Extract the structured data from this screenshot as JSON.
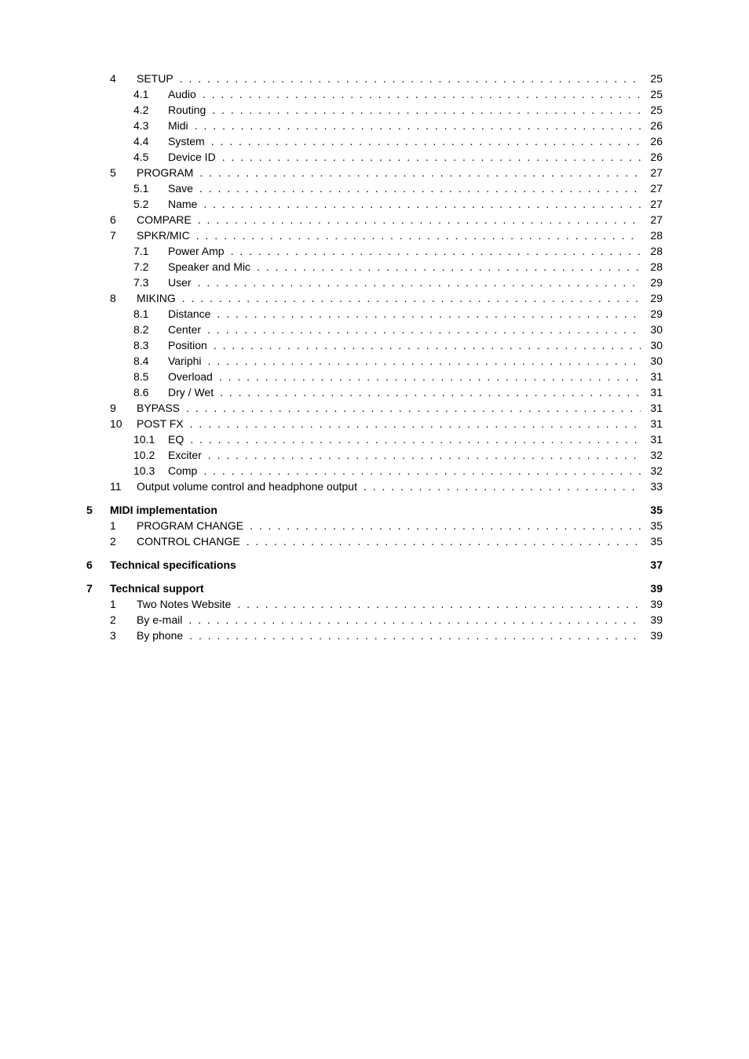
{
  "toc": [
    {
      "level": 2,
      "num": "4",
      "sub": "",
      "title": "SETUP",
      "page": "25",
      "bold": false,
      "dotted": true,
      "gap": false
    },
    {
      "level": 3,
      "num": "",
      "sub": "4.1",
      "title": "Audio",
      "page": "25",
      "bold": false,
      "dotted": true,
      "gap": false
    },
    {
      "level": 3,
      "num": "",
      "sub": "4.2",
      "title": "Routing",
      "page": "25",
      "bold": false,
      "dotted": true,
      "gap": false
    },
    {
      "level": 3,
      "num": "",
      "sub": "4.3",
      "title": "Midi",
      "page": "26",
      "bold": false,
      "dotted": true,
      "gap": false
    },
    {
      "level": 3,
      "num": "",
      "sub": "4.4",
      "title": "System",
      "page": "26",
      "bold": false,
      "dotted": true,
      "gap": false
    },
    {
      "level": 3,
      "num": "",
      "sub": "4.5",
      "title": "Device ID",
      "page": "26",
      "bold": false,
      "dotted": true,
      "gap": false
    },
    {
      "level": 2,
      "num": "5",
      "sub": "",
      "title": "PROGRAM",
      "page": "27",
      "bold": false,
      "dotted": true,
      "gap": false
    },
    {
      "level": 3,
      "num": "",
      "sub": "5.1",
      "title": "Save",
      "page": "27",
      "bold": false,
      "dotted": true,
      "gap": false
    },
    {
      "level": 3,
      "num": "",
      "sub": "5.2",
      "title": "Name",
      "page": "27",
      "bold": false,
      "dotted": true,
      "gap": false
    },
    {
      "level": 2,
      "num": "6",
      "sub": "",
      "title": "COMPARE",
      "page": "27",
      "bold": false,
      "dotted": true,
      "gap": false
    },
    {
      "level": 2,
      "num": "7",
      "sub": "",
      "title": "SPKR/MIC",
      "page": "28",
      "bold": false,
      "dotted": true,
      "gap": false
    },
    {
      "level": 3,
      "num": "",
      "sub": "7.1",
      "title": "Power Amp",
      "page": "28",
      "bold": false,
      "dotted": true,
      "gap": false
    },
    {
      "level": 3,
      "num": "",
      "sub": "7.2",
      "title": "Speaker and Mic",
      "page": "28",
      "bold": false,
      "dotted": true,
      "gap": false
    },
    {
      "level": 3,
      "num": "",
      "sub": "7.3",
      "title": "User",
      "page": "29",
      "bold": false,
      "dotted": true,
      "gap": false
    },
    {
      "level": 2,
      "num": "8",
      "sub": "",
      "title": "MIKING",
      "page": "29",
      "bold": false,
      "dotted": true,
      "gap": false
    },
    {
      "level": 3,
      "num": "",
      "sub": "8.1",
      "title": "Distance",
      "page": "29",
      "bold": false,
      "dotted": true,
      "gap": false
    },
    {
      "level": 3,
      "num": "",
      "sub": "8.2",
      "title": "Center",
      "page": "30",
      "bold": false,
      "dotted": true,
      "gap": false
    },
    {
      "level": 3,
      "num": "",
      "sub": "8.3",
      "title": "Position",
      "page": "30",
      "bold": false,
      "dotted": true,
      "gap": false
    },
    {
      "level": 3,
      "num": "",
      "sub": "8.4",
      "title": "Variphi",
      "page": "30",
      "bold": false,
      "dotted": true,
      "gap": false
    },
    {
      "level": 3,
      "num": "",
      "sub": "8.5",
      "title": "Overload",
      "page": "31",
      "bold": false,
      "dotted": true,
      "gap": false
    },
    {
      "level": 3,
      "num": "",
      "sub": "8.6",
      "title": "Dry / Wet",
      "page": "31",
      "bold": false,
      "dotted": true,
      "gap": false
    },
    {
      "level": 2,
      "num": "9",
      "sub": "",
      "title": "BYPASS",
      "page": "31",
      "bold": false,
      "dotted": true,
      "gap": false
    },
    {
      "level": 2,
      "num": "10",
      "sub": "",
      "title": "POST FX",
      "page": "31",
      "bold": false,
      "dotted": true,
      "gap": false
    },
    {
      "level": 3,
      "num": "",
      "sub": "10.1",
      "title": "EQ",
      "page": "31",
      "bold": false,
      "dotted": true,
      "gap": false
    },
    {
      "level": 3,
      "num": "",
      "sub": "10.2",
      "title": "Exciter",
      "page": "32",
      "bold": false,
      "dotted": true,
      "gap": false
    },
    {
      "level": 3,
      "num": "",
      "sub": "10.3",
      "title": "Comp",
      "page": "32",
      "bold": false,
      "dotted": true,
      "gap": false
    },
    {
      "level": 2,
      "num": "11",
      "sub": "",
      "title": "Output volume control and headphone output",
      "page": "33",
      "bold": false,
      "dotted": true,
      "gap": false
    },
    {
      "level": 1,
      "num": "5",
      "sub": "",
      "title": "MIDI implementation",
      "page": "35",
      "bold": true,
      "dotted": false,
      "gap": true
    },
    {
      "level": 2,
      "num": "1",
      "sub": "",
      "title": "PROGRAM CHANGE",
      "page": "35",
      "bold": false,
      "dotted": true,
      "gap": false
    },
    {
      "level": 2,
      "num": "2",
      "sub": "",
      "title": "CONTROL CHANGE",
      "page": "35",
      "bold": false,
      "dotted": true,
      "gap": false
    },
    {
      "level": 1,
      "num": "6",
      "sub": "",
      "title": "Technical specifications",
      "page": "37",
      "bold": true,
      "dotted": false,
      "gap": true
    },
    {
      "level": 1,
      "num": "7",
      "sub": "",
      "title": "Technical support",
      "page": "39",
      "bold": true,
      "dotted": false,
      "gap": true
    },
    {
      "level": 2,
      "num": "1",
      "sub": "",
      "title": "Two Notes Website",
      "page": "39",
      "bold": false,
      "dotted": true,
      "gap": false
    },
    {
      "level": 2,
      "num": "2",
      "sub": "",
      "title": "By e-mail",
      "page": "39",
      "bold": false,
      "dotted": true,
      "gap": false
    },
    {
      "level": 2,
      "num": "3",
      "sub": "",
      "title": "By phone",
      "page": "39",
      "bold": false,
      "dotted": true,
      "gap": false
    }
  ]
}
